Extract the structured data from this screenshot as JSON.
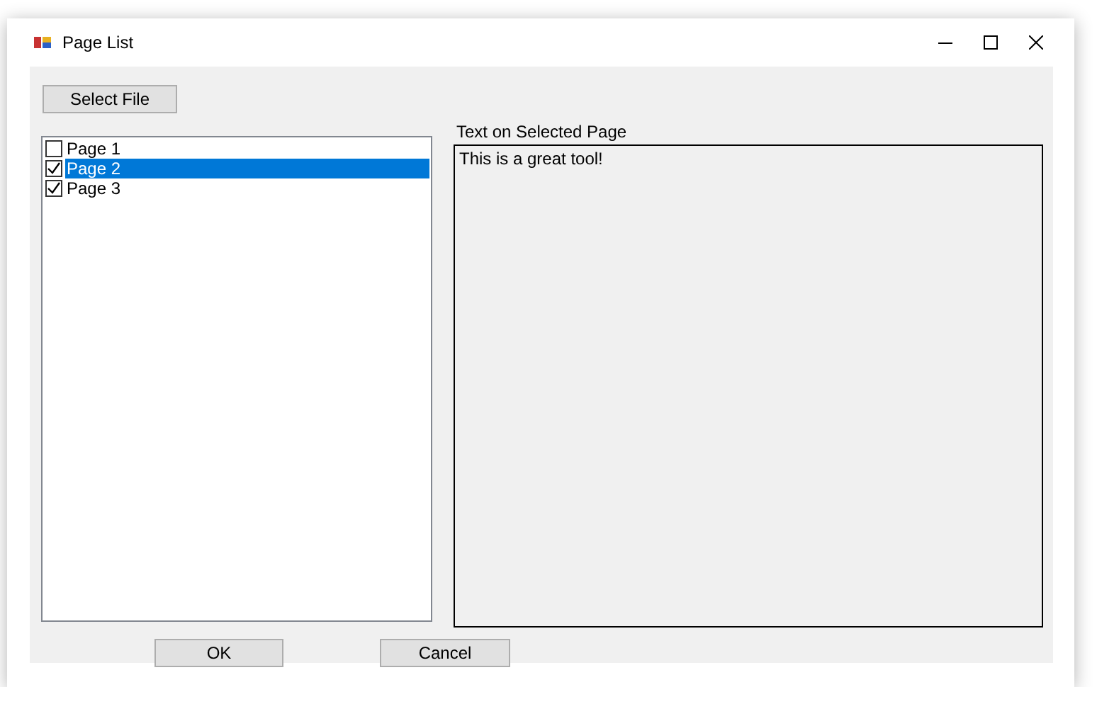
{
  "window": {
    "title": "Page List"
  },
  "select_button": "Select File",
  "pages": [
    {
      "label": "Page 1",
      "checked": false,
      "selected": false
    },
    {
      "label": "Page 2",
      "checked": true,
      "selected": true
    },
    {
      "label": "Page 3",
      "checked": true,
      "selected": false
    }
  ],
  "text_label": "Text on Selected Page",
  "page_text": "This is a great tool!",
  "buttons": [
    "OK",
    "Cancel"
  ]
}
